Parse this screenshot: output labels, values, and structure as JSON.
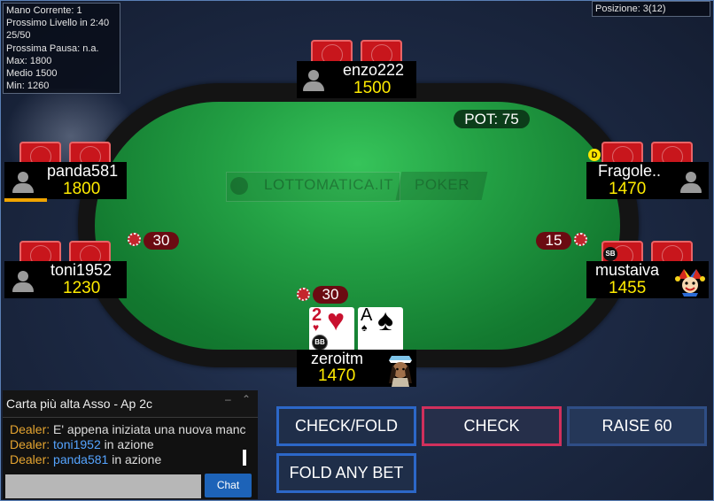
{
  "info_panel": {
    "lines": [
      "Mano Corrente: 1",
      "Prossimo Livello in 2:40",
      "25/50",
      "Prossima Pausa: n.a.",
      "Max: 1800",
      "Medio 1500",
      "Min: 1260"
    ]
  },
  "position": "Posizione: 3(12)",
  "logo": {
    "brand": "LOTTOMATICA.IT",
    "product": "POKER"
  },
  "pot": "POT: 75",
  "players": {
    "top": {
      "name": "enzo222",
      "stack": "1500"
    },
    "left_upper": {
      "name": "panda581",
      "stack": "1800"
    },
    "left_lower": {
      "name": "toni1952",
      "stack": "1230",
      "bet": "30"
    },
    "right_upper": {
      "name": "Fragole..",
      "stack": "1470",
      "badge": "D"
    },
    "right_lower": {
      "name": "mustaiva",
      "stack": "1455",
      "bet": "15",
      "badge": "SB"
    },
    "hero": {
      "name": "zeroitm",
      "stack": "1470",
      "bet": "30",
      "badge": "BB",
      "cards": [
        {
          "rank": "2",
          "suit": "♥",
          "color": "#c8102e"
        },
        {
          "rank": "A",
          "suit": "♠",
          "color": "#000000"
        }
      ]
    }
  },
  "chat": {
    "header": "Carta più alta Asso - Ap 2c",
    "messages": [
      {
        "sender": "Dealer:",
        "user": "",
        "text": " E' appena iniziata una nuova manc"
      },
      {
        "sender": "Dealer:",
        "user": "toni1952",
        "text": " in azione"
      },
      {
        "sender": "Dealer:",
        "user": "panda581",
        "text": " in azione"
      }
    ],
    "button": "Chat"
  },
  "actions": {
    "check_fold": "CHECK/FOLD",
    "check": "CHECK",
    "raise": "RAISE 60",
    "fold_any": "FOLD ANY BET"
  },
  "colors": {
    "stack": "#ffeb00",
    "felt": "#1e9a40",
    "dealer_name": "#e6a530",
    "user_link": "#55a4ff"
  }
}
